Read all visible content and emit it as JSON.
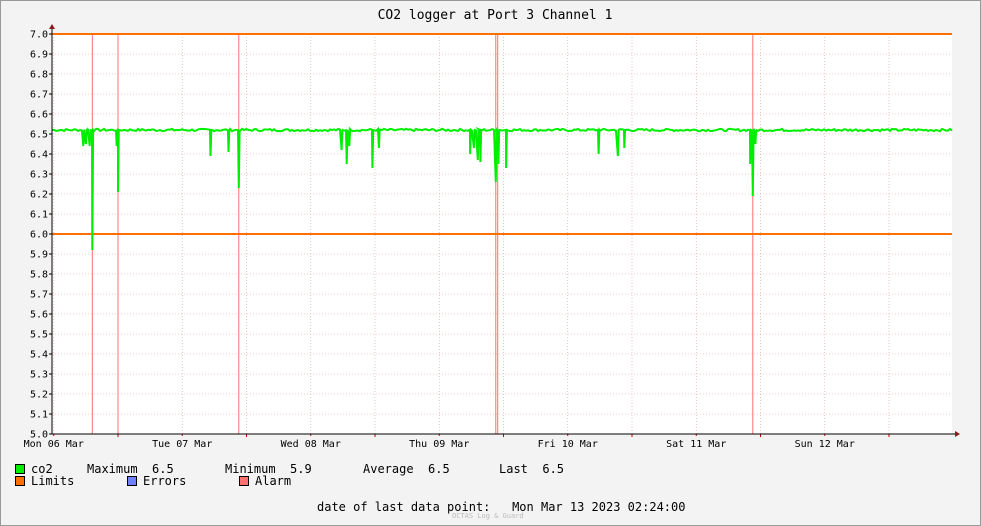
{
  "colors": {
    "co2": "#00ee00",
    "limits": "#ff7000",
    "errors": "#7080ff",
    "alarm": "#ff7070"
  },
  "chart_data": {
    "type": "line",
    "title": "CO2 logger at Port 3 Channel 1",
    "ylim": [
      5.0,
      7.0
    ],
    "yticks": [
      "5.0",
      "5.1",
      "5.2",
      "5.3",
      "5.4",
      "5.5",
      "5.6",
      "5.7",
      "5.8",
      "5.9",
      "6.0",
      "6.1",
      "6.2",
      "6.3",
      "6.4",
      "6.5",
      "6.6",
      "6.7",
      "6.8",
      "6.9",
      "7.0"
    ],
    "xlim_days": [
      0,
      7.0
    ],
    "day_boundaries": [
      0.0,
      1.0,
      2.0,
      3.0,
      4.0,
      5.0,
      6.0
    ],
    "x_labels": [
      {
        "day": 0.0,
        "label": "Mon 06 Mar"
      },
      {
        "day": 1.0,
        "label": "Tue 07 Mar"
      },
      {
        "day": 2.0,
        "label": "Wed 08 Mar"
      },
      {
        "day": 3.0,
        "label": "Thu 09 Mar"
      },
      {
        "day": 4.0,
        "label": "Fri 10 Mar"
      },
      {
        "day": 5.0,
        "label": "Sat 11 Mar"
      },
      {
        "day": 6.0,
        "label": "Sun 12 Mar"
      }
    ],
    "limits": [
      6.0,
      7.0
    ],
    "alarm_days": [
      -0.2,
      0.0,
      0.94,
      2.94,
      2.955,
      4.94
    ],
    "series": [
      {
        "name": "co2",
        "baseline": 6.52,
        "dips": [
          [
            -0.27,
            6.44
          ],
          [
            -0.25,
            6.45
          ],
          [
            -0.22,
            6.44
          ],
          [
            -0.2,
            5.92
          ],
          [
            -0.01,
            6.44
          ],
          [
            0.0,
            6.21
          ],
          [
            0.72,
            6.39
          ],
          [
            0.86,
            6.41
          ],
          [
            0.94,
            6.23
          ],
          [
            1.74,
            6.42
          ],
          [
            1.78,
            6.35
          ],
          [
            1.8,
            6.44
          ],
          [
            1.98,
            6.33
          ],
          [
            2.03,
            6.43
          ],
          [
            2.74,
            6.4
          ],
          [
            2.77,
            6.43
          ],
          [
            2.8,
            6.37
          ],
          [
            2.82,
            6.36
          ],
          [
            2.94,
            6.26
          ],
          [
            2.96,
            6.35
          ],
          [
            3.02,
            6.33
          ],
          [
            3.74,
            6.4
          ],
          [
            3.89,
            6.39
          ],
          [
            3.94,
            6.43
          ],
          [
            4.92,
            6.35
          ],
          [
            4.94,
            6.19
          ],
          [
            4.96,
            6.45
          ]
        ]
      }
    ]
  },
  "legend": {
    "co2_label": "co2",
    "max_label": "Maximum",
    "max_value": "6.5",
    "min_label": "Minimum",
    "min_value": "5.9",
    "avg_label": "Average",
    "avg_value": "6.5",
    "last_label": "Last",
    "last_value": "6.5",
    "limits_label": "Limits",
    "errors_label": "Errors",
    "alarm_label": "Alarm"
  },
  "footer": {
    "last_point_label": "date of last data point:",
    "last_point_value": "Mon Mar 13 2023 02:24:00",
    "watermark": "OCTAS Log & Guard"
  }
}
